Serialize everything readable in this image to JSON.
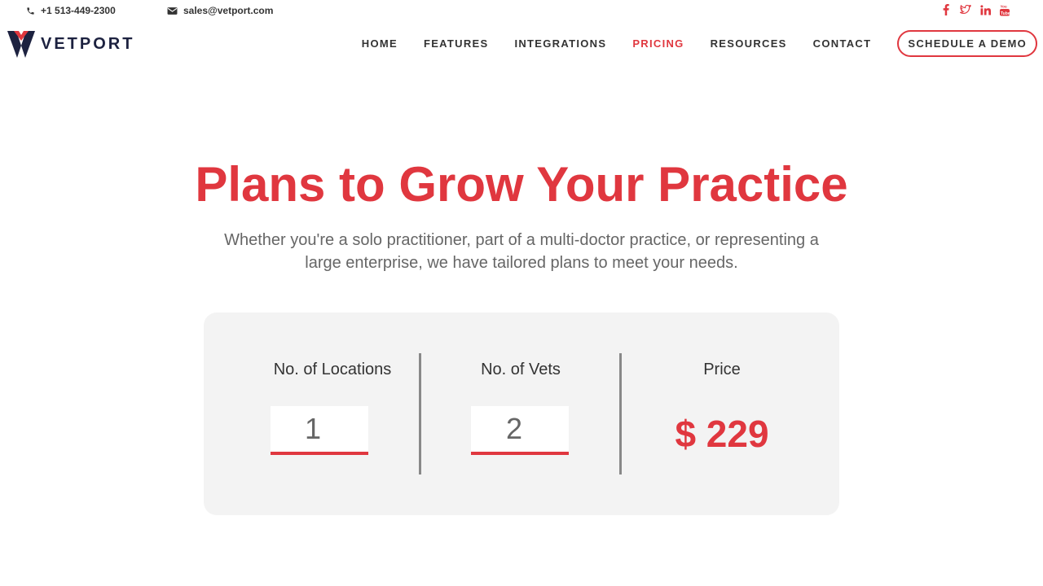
{
  "topbar": {
    "phone": "+1 513-449-2300",
    "email": "sales@vetport.com",
    "socials": [
      "facebook-icon",
      "twitter-icon",
      "linkedin-icon",
      "youtube-icon"
    ]
  },
  "brand": {
    "logo_text": "VETPORT",
    "accent": "#e0373f",
    "navy": "#1d2240"
  },
  "nav": {
    "items": [
      {
        "label": "HOME"
      },
      {
        "label": "FEATURES"
      },
      {
        "label": "INTEGRATIONS"
      },
      {
        "label": "PRICING",
        "active": true
      },
      {
        "label": "RESOURCES"
      },
      {
        "label": "CONTACT"
      }
    ],
    "cta": "SCHEDULE A DEMO"
  },
  "hero": {
    "title": "Plans to Grow Your Practice",
    "subtitle": "Whether you're a solo practitioner, part of a multi-doctor practice, or representing a large enterprise, we have tailored plans to meet your needs."
  },
  "calculator": {
    "locations_label": "No. of Locations",
    "locations_value": "1",
    "vets_label": "No. of Vets",
    "vets_value": "2",
    "price_label": "Price",
    "price_value": "$ 229"
  }
}
